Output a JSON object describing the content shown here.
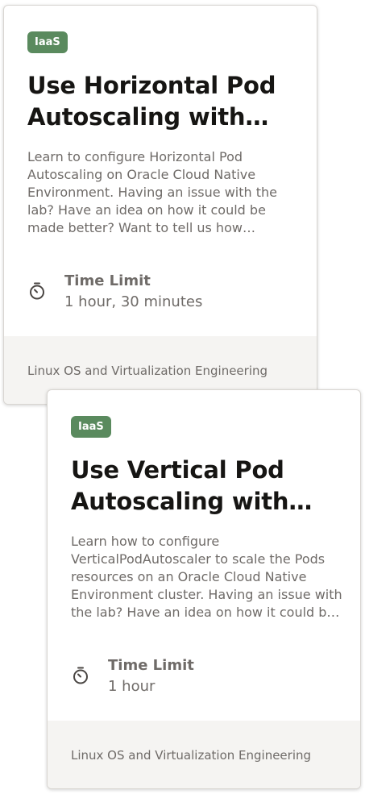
{
  "cards": [
    {
      "badge": "IaaS",
      "title": "Use Horizontal Pod Autoscaling with…",
      "description": "Learn to configure Horizontal Pod Autoscaling on Oracle Cloud Native Environment. Having an issue with the lab? Have an idea on how it could be made better? Want to tell us how…",
      "time_label": "Time Limit",
      "time_value": "1 hour, 30 minutes",
      "time_icon": "stopwatch-icon",
      "footer": "Linux OS and Virtualization Engineering"
    },
    {
      "badge": "IaaS",
      "title": "Use Vertical Pod Autoscaling with…",
      "description": "Learn how to configure VerticalPodAutoscaler to scale the Pods resources on an Oracle Cloud Native Environment cluster. Having an issue with the lab? Have an idea on how it could b…",
      "time_label": "Time Limit",
      "time_value": "1 hour",
      "time_icon": "stopwatch-icon",
      "footer": "Linux OS and Virtualization Engineering"
    }
  ],
  "colors": {
    "badge_bg": "#5a8a5e",
    "title_text": "#161513",
    "body_text": "#6f6b68",
    "footer_bg": "#f5f4f2"
  }
}
